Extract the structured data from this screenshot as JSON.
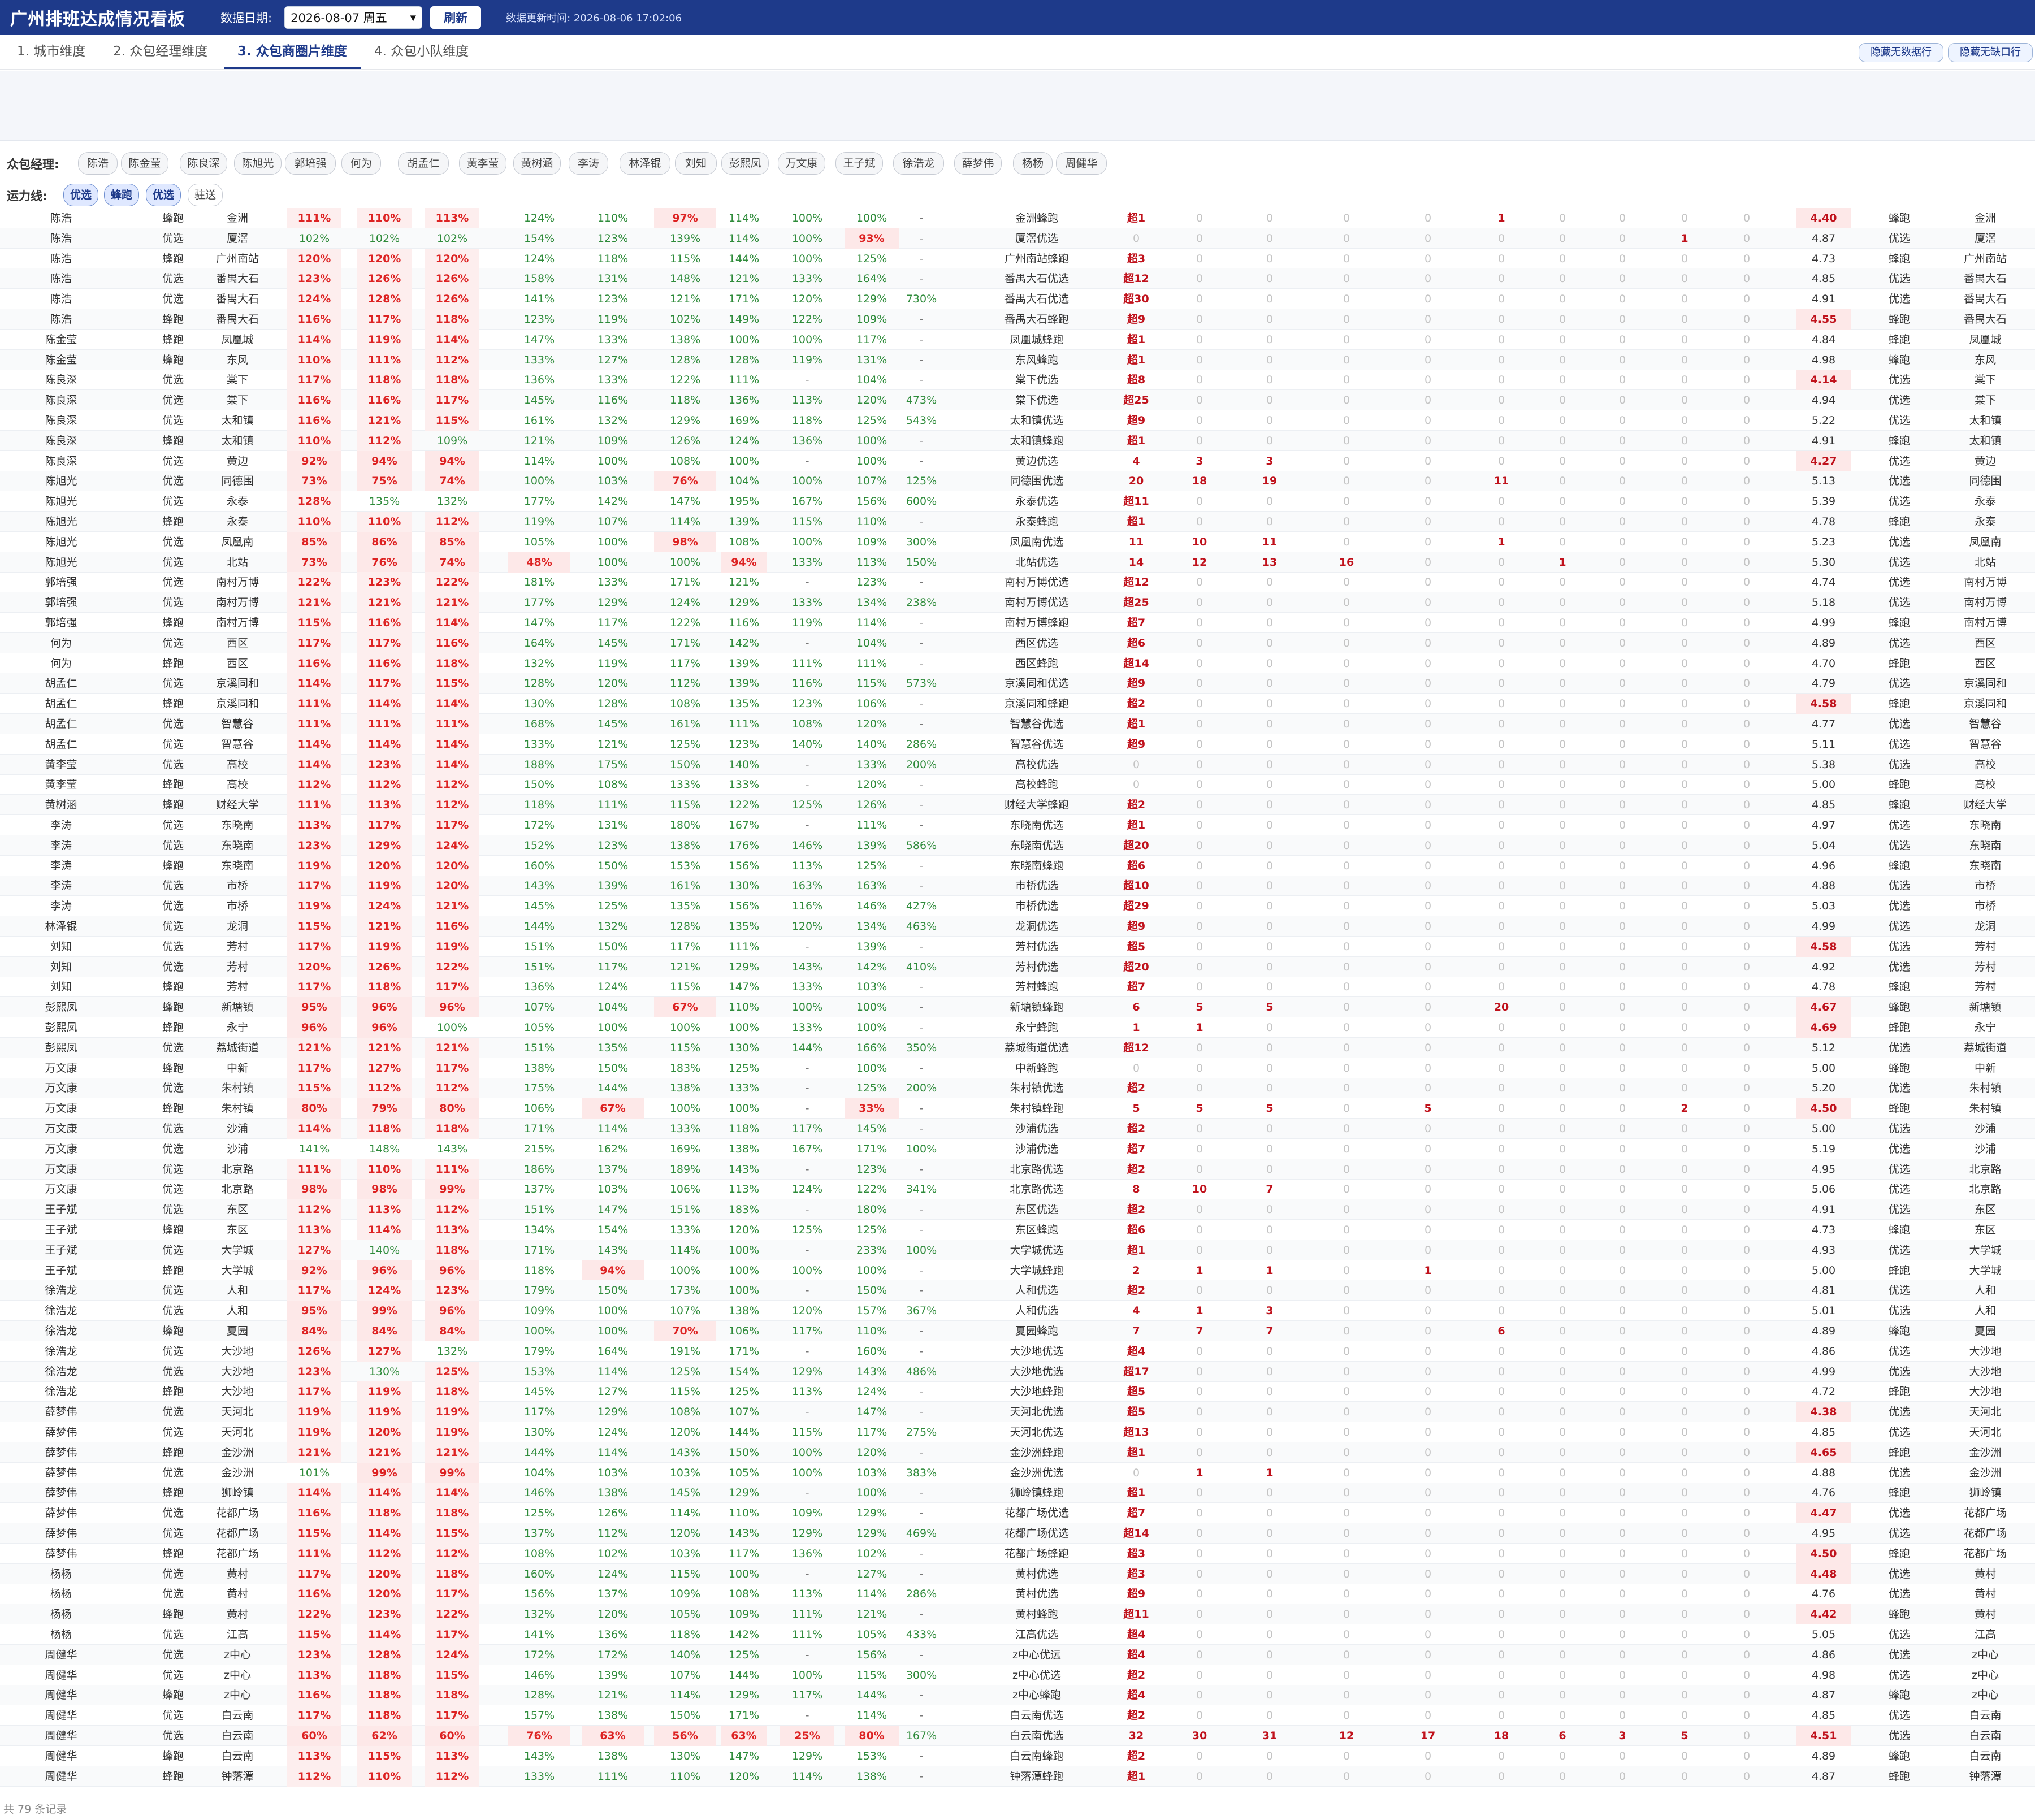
{
  "header": {
    "title": "广州排班达成情况看板",
    "date_label": "数据日期:",
    "date_value": "2026-08-07 周五",
    "refresh_label": "刷新",
    "update_time": "数据更新时间: 2026-08-06 17:02:06"
  },
  "tabs": [
    {
      "label": "1. 城市维度"
    },
    {
      "label": "2. 众包经理维度"
    },
    {
      "label": "3. 众包商圈片维度"
    },
    {
      "label": "4. 众包小队维度"
    }
  ],
  "buttons": {
    "hide_no_data": "隐藏无数据行",
    "hide_no_gap": "隐藏无缺口行"
  },
  "filters": {
    "manager_label": "众包经理:",
    "managers": [
      "陈浩",
      "陈金莹",
      "陈良深",
      "陈旭光",
      "郭培强",
      "何为",
      "胡孟仁",
      "黄李莹",
      "黄树涵",
      "李涛",
      "林泽锟",
      "刘知",
      "彭熙凤",
      "万文康",
      "王子斌",
      "徐浩龙",
      "薛梦伟",
      "杨杨",
      "周健华"
    ],
    "line_label": "运力线:",
    "lines": [
      "优选",
      "蜂跑",
      "优选",
      "驻送"
    ]
  },
  "rows": [
    "陈浩|蜂跑|金洲|111%|110%|113%|124%|110%|97%|114%|100%|100%|-|金洲蜂跑|超1|0|0|0|0|1|0|0|0|0|4.40|蜂跑|金洲",
    "陈浩|优选|厦滘|102%|102%|102%|154%|123%|139%|114%|100%|93%|-|厦滘优选|0|0|0|0|0|0|0|0|1|0|4.87|优选|厦滘",
    "陈浩|蜂跑|广州南站|120%|120%|120%|124%|118%|115%|144%|100%|125%|-|广州南站蜂跑|超3|0|0|0|0|0|0|0|0|0|4.73|蜂跑|广州南站",
    "陈浩|优选|番禺大石|123%|126%|126%|158%|131%|148%|121%|133%|164%|-|番禺大石优选|超12|0|0|0|0|0|0|0|0|0|4.85|优选|番禺大石",
    "陈浩|优选|番禺大石|124%|128%|126%|141%|123%|121%|171%|120%|129%|730%|番禺大石优选|超30|0|0|0|0|0|0|0|0|0|4.91|优选|番禺大石",
    "陈浩|蜂跑|番禺大石|116%|117%|118%|123%|119%|102%|149%|122%|109%|-|番禺大石蜂跑|超9|0|0|0|0|0|0|0|0|0|4.55|蜂跑|番禺大石",
    "陈金莹|蜂跑|凤凰城|114%|119%|114%|147%|133%|138%|100%|100%|117%|-|凤凰城蜂跑|超1|0|0|0|0|0|0|0|0|0|4.84|蜂跑|凤凰城",
    "陈金莹|蜂跑|东风|110%|111%|112%|133%|127%|128%|128%|119%|131%|-|东风蜂跑|超1|0|0|0|0|0|0|0|0|0|4.98|蜂跑|东风",
    "陈良深|优选|棠下|117%|118%|118%|136%|133%|122%|111%|-|104%|-|棠下优选|超8|0|0|0|0|0|0|0|0|0|4.14|优选|棠下",
    "陈良深|优选|棠下|116%|116%|117%|145%|116%|118%|136%|113%|120%|473%|棠下优选|超25|0|0|0|0|0|0|0|0|0|4.94|优选|棠下",
    "陈良深|优选|太和镇|116%|121%|115%|161%|132%|129%|169%|118%|125%|543%|太和镇优选|超9|0|0|0|0|0|0|0|0|0|5.22|优选|太和镇",
    "陈良深|蜂跑|太和镇|110%|112%|109%|121%|109%|126%|124%|136%|100%|-|太和镇蜂跑|超1|0|0|0|0|0|0|0|0|0|4.91|蜂跑|太和镇",
    "陈良深|优选|黄边|92%|94%|94%|114%|100%|108%|100%|-|100%|-|黄边优选|4|3|3|0|0|0|0|0|0|0|4.27|优选|黄边",
    "陈旭光|优选|同德围|73%|75%|74%|100%|103%|76%|104%|100%|107%|125%|同德围优选|20|18|19|0|0|11|0|0|0|0|5.13|优选|同德围",
    "陈旭光|优选|永泰|128%|135%|132%|177%|142%|147%|195%|167%|156%|600%|永泰优选|超11|0|0|0|0|0|0|0|0|0|5.39|优选|永泰",
    "陈旭光|蜂跑|永泰|110%|110%|112%|119%|107%|114%|139%|115%|110%|-|永泰蜂跑|超1|0|0|0|0|0|0|0|0|0|4.78|蜂跑|永泰",
    "陈旭光|优选|凤凰南|85%|86%|85%|105%|100%|98%|108%|100%|109%|300%|凤凰南优选|11|10|11|0|0|1|0|0|0|0|5.23|优选|凤凰南",
    "陈旭光|优选|北站|73%|76%|74%|48%|100%|100%|94%|133%|113%|150%|北站优选|14|12|13|16|0|0|1|0|0|0|5.30|优选|北站",
    "郭培强|优选|南村万博|122%|123%|122%|181%|133%|171%|121%|-|123%|-|南村万博优选|超12|0|0|0|0|0|0|0|0|0|4.74|优选|南村万博",
    "郭培强|优选|南村万博|121%|121%|121%|177%|129%|124%|129%|133%|134%|238%|南村万博优选|超25|0|0|0|0|0|0|0|0|0|5.18|优选|南村万博",
    "郭培强|蜂跑|南村万博|115%|116%|114%|147%|117%|122%|116%|119%|114%|-|南村万博蜂跑|超7|0|0|0|0|0|0|0|0|0|4.99|蜂跑|南村万博",
    "何为|优选|西区|117%|117%|116%|164%|145%|171%|142%|-|104%|-|西区优选|超6|0|0|0|0|0|0|0|0|0|4.89|优选|西区",
    "何为|蜂跑|西区|116%|116%|118%|132%|119%|117%|139%|111%|111%|-|西区蜂跑|超14|0|0|0|0|0|0|0|0|0|4.70|蜂跑|西区",
    "胡孟仁|优选|京溪同和|114%|117%|115%|128%|120%|112%|139%|116%|115%|573%|京溪同和优选|超9|0|0|0|0|0|0|0|0|0|4.79|优选|京溪同和",
    "胡孟仁|蜂跑|京溪同和|111%|114%|114%|130%|128%|108%|135%|123%|106%|-|京溪同和蜂跑|超2|0|0|0|0|0|0|0|0|0|4.58|蜂跑|京溪同和",
    "胡孟仁|优选|智慧谷|111%|111%|111%|168%|145%|161%|111%|108%|120%|-|智慧谷优选|超1|0|0|0|0|0|0|0|0|0|4.77|优选|智慧谷",
    "胡孟仁|优选|智慧谷|114%|114%|114%|133%|121%|125%|123%|140%|140%|286%|智慧谷优选|超9|0|0|0|0|0|0|0|0|0|5.11|优选|智慧谷",
    "黄李莹|优选|高校|114%|123%|114%|188%|175%|150%|140%|-|133%|200%|高校优选|0|0|0|0|0|0|0|0|0|0|5.38|优选|高校",
    "黄李莹|蜂跑|高校|112%|112%|112%|150%|108%|133%|133%|-|120%|-|高校蜂跑|0|0|0|0|0|0|0|0|0|0|5.00|蜂跑|高校",
    "黄树涵|蜂跑|财经大学|111%|113%|112%|118%|111%|115%|122%|125%|126%|-|财经大学蜂跑|超2|0|0|0|0|0|0|0|0|0|4.85|蜂跑|财经大学",
    "李涛|优选|东晓南|113%|117%|117%|172%|131%|180%|167%|-|111%|-|东晓南优选|超1|0|0|0|0|0|0|0|0|0|4.97|优选|东晓南",
    "李涛|优选|东晓南|123%|129%|124%|152%|123%|138%|176%|146%|139%|586%|东晓南优选|超20|0|0|0|0|0|0|0|0|0|5.04|优选|东晓南",
    "李涛|蜂跑|东晓南|119%|120%|120%|160%|150%|153%|156%|113%|125%|-|东晓南蜂跑|超6|0|0|0|0|0|0|0|0|0|4.96|蜂跑|东晓南",
    "李涛|优选|市桥|117%|119%|120%|143%|139%|161%|130%|163%|163%|-|市桥优选|超10|0|0|0|0|0|0|0|0|0|4.88|优选|市桥",
    "李涛|优选|市桥|119%|124%|121%|145%|125%|135%|156%|116%|146%|427%|市桥优选|超29|0|0|0|0|0|0|0|0|0|5.03|优选|市桥",
    "林泽锟|优选|龙洞|115%|121%|116%|144%|132%|128%|135%|120%|134%|463%|龙洞优选|超9|0|0|0|0|0|0|0|0|0|4.99|优选|龙洞",
    "刘知|优选|芳村|117%|119%|119%|151%|150%|117%|111%|-|139%|-|芳村优选|超5|0|0|0|0|0|0|0|0|0|4.58|优选|芳村",
    "刘知|优选|芳村|120%|126%|122%|151%|117%|121%|129%|143%|142%|410%|芳村优选|超20|0|0|0|0|0|0|0|0|0|4.92|优选|芳村",
    "刘知|蜂跑|芳村|117%|118%|117%|136%|124%|115%|147%|133%|103%|-|芳村蜂跑|超7|0|0|0|0|0|0|0|0|0|4.78|蜂跑|芳村",
    "彭熙凤|蜂跑|新塘镇|95%|96%|96%|107%|104%|67%|110%|100%|100%|-|新塘镇蜂跑|6|5|5|0|0|20|0|0|0|0|4.67|蜂跑|新塘镇",
    "彭熙凤|蜂跑|永宁|96%|96%|100%|105%|100%|100%|100%|133%|100%|-|永宁蜂跑|1|1|0|0|0|0|0|0|0|0|4.69|蜂跑|永宁",
    "彭熙凤|优选|荔城街道|121%|121%|121%|151%|135%|115%|130%|144%|166%|350%|荔城街道优选|超12|0|0|0|0|0|0|0|0|0|5.12|优选|荔城街道",
    "万文康|蜂跑|中新|117%|127%|117%|138%|150%|183%|125%|-|100%|-|中新蜂跑|0|0|0|0|0|0|0|0|0|0|5.00|蜂跑|中新",
    "万文康|优选|朱村镇|115%|112%|112%|175%|144%|138%|133%|-|125%|200%|朱村镇优选|超2|0|0|0|0|0|0|0|0|0|5.20|优选|朱村镇",
    "万文康|蜂跑|朱村镇|80%|79%|80%|106%|67%|100%|100%|-|33%|-|朱村镇蜂跑|5|5|5|0|5|0|0|0|2|0|4.50|蜂跑|朱村镇",
    "万文康|优选|沙浦|114%|118%|118%|171%|114%|133%|118%|117%|145%|-|沙浦优选|超2|0|0|0|0|0|0|0|0|0|5.00|优选|沙浦",
    "万文康|优选|沙浦|141%|148%|143%|215%|162%|169%|138%|167%|171%|100%|沙浦优选|超7|0|0|0|0|0|0|0|0|0|5.19|优选|沙浦",
    "万文康|优选|北京路|111%|110%|111%|186%|137%|189%|143%|-|123%|-|北京路优选|超2|0|0|0|0|0|0|0|0|0|4.95|优选|北京路",
    "万文康|优选|北京路|98%|98%|99%|137%|103%|106%|113%|124%|122%|341%|北京路优选|8|10|7|0|0|0|0|0|0|0|5.06|优选|北京路",
    "王子斌|优选|东区|112%|113%|112%|151%|147%|151%|183%|-|180%|-|东区优选|超2|0|0|0|0|0|0|0|0|0|4.91|优选|东区",
    "王子斌|蜂跑|东区|113%|114%|113%|134%|154%|133%|120%|125%|138%|125%|-|东区蜂跑|超6|0|0|0|0|0|0|0|0|0|4.73|蜂跑|东区",
    "王子斌|优选|大学城|127%|140%|118%|171%|143%|114%|100%|-|233%|100%|大学城优选|超1|0|0|0|0|0|0|0|0|0|4.93|优选|大学城",
    "王子斌|蜂跑|大学城|92%|96%|96%|118%|94%|100%|100%|100%|100%|-|大学城蜂跑|2|1|1|0|1|0|0|0|0|0|5.00|蜂跑|大学城",
    "徐浩龙|优选|人和|117%|124%|123%|179%|150%|173%|100%|-|150%|-|人和优选|超2|0|0|0|0|0|0|0|0|0|4.81|优选|人和",
    "徐浩龙|优选|人和|95%|99%|96%|109%|100%|107%|138%|120%|157%|367%|人和优选|4|1|3|0|0|0|0|0|0|0|5.01|优选|人和",
    "徐浩龙|蜂跑|夏园|84%|84%|84%|100%|100%|70%|106%|117%|110%|-|夏园蜂跑|7|7|7|0|0|6|0|0|0|0|4.89|蜂跑|夏园",
    "徐浩龙|优选|大沙地|126%|127%|132%|179%|164%|191%|171%|-|160%|-|大沙地优选|超4|0|0|0|0|0|0|0|0|0|4.86|优选|大沙地",
    "徐浩龙|优选|大沙地|123%|130%|125%|153%|114%|125%|154%|129%|143%|486%|大沙地优选|超17|0|0|0|0|0|0|0|0|0|4.99|优选|大沙地",
    "徐浩龙|蜂跑|大沙地|117%|119%|118%|145%|127%|115%|125%|113%|124%|-|大沙地蜂跑|超5|0|0|0|0|0|0|0|0|0|4.72|蜂跑|大沙地",
    "薛梦伟|优选|天河北|119%|119%|119%|117%|129%|108%|107%|-|147%|-|天河北优选|超5|0|0|0|0|0|0|0|0|0|4.38|优选|天河北",
    "薛梦伟|优选|天河北|119%|120%|119%|130%|124%|120%|144%|115%|117%|275%|天河北优选|超13|0|0|0|0|0|0|0|0|0|4.85|优选|天河北",
    "薛梦伟|蜂跑|金沙洲|121%|121%|121%|144%|114%|143%|150%|100%|120%|-|金沙洲蜂跑|超1|0|0|0|0|0|0|0|0|0|4.65|蜂跑|金沙洲",
    "薛梦伟|优选|金沙洲|101%|99%|99%|104%|103%|103%|105%|100%|103%|383%|金沙洲优选|0|1|1|0|0|0|0|0|0|0|4.88|优选|金沙洲",
    "薛梦伟|蜂跑|狮岭镇|114%|114%|114%|146%|138%|145%|129%|-|100%|-|狮岭镇蜂跑|超1|0|0|0|0|0|0|0|0|0|4.76|蜂跑|狮岭镇",
    "薛梦伟|优选|花都广场|116%|118%|118%|125%|126%|114%|110%|109%|129%|-|花都广场优选|超7|0|0|0|0|0|0|0|0|0|4.47|优选|花都广场",
    "薛梦伟|优选|花都广场|115%|114%|115%|137%|112%|120%|143%|129%|129%|469%|花都广场优选|超14|0|0|0|0|0|0|0|0|0|4.95|优选|花都广场",
    "薛梦伟|蜂跑|花都广场|111%|112%|112%|108%|102%|103%|117%|136%|102%|-|花都广场蜂跑|超3|0|0|0|0|0|0|0|0|0|4.50|蜂跑|花都广场",
    "杨杨|优选|黄村|117%|120%|118%|160%|124%|115%|100%|-|127%|-|黄村优选|超3|0|0|0|0|0|0|0|0|0|4.48|优选|黄村",
    "杨杨|优选|黄村|116%|120%|117%|156%|137%|109%|108%|113%|114%|286%|黄村优选|超9|0|0|0|0|0|0|0|0|0|4.76|优选|黄村",
    "杨杨|蜂跑|黄村|122%|123%|122%|132%|120%|105%|109%|111%|121%|-|黄村蜂跑|超11|0|0|0|0|0|0|0|0|0|4.42|蜂跑|黄村",
    "杨杨|优选|江高|115%|114%|117%|141%|136%|118%|142%|111%|105%|433%|江高优选|超4|0|0|0|0|0|0|0|0|0|5.05|优选|江高",
    "周健华|优选|z中心|123%|128%|124%|172%|172%|140%|125%|-|156%|-|z中心优远|超4|0|0|0|0|0|0|0|0|0|4.86|优选|z中心",
    "周健华|优选|z中心|113%|118%|115%|146%|139%|107%|144%|100%|115%|300%|z中心优选|超2|0|0|0|0|0|0|0|0|0|4.98|优选|z中心",
    "周健华|蜂跑|z中心|116%|118%|118%|128%|121%|114%|129%|117%|144%|-|z中心蜂跑|超4|0|0|0|0|0|0|0|0|0|4.87|蜂跑|z中心",
    "周健华|优选|白云南|117%|118%|117%|157%|138%|150%|171%|-|114%|-|白云南优选|超2|0|0|0|0|0|0|0|0|0|4.85|优选|白云南",
    "周健华|优选|白云南|60%|62%|60%|76%|63%|56%|63%|25%|80%|167%|白云南优选|32|30|31|12|17|18|6|3|5|0|4.51|优选|白云南",
    "周健华|蜂跑|白云南|113%|115%|113%|143%|138%|130%|147%|129%|153%|-|白云南蜂跑|超2|0|0|0|0|0|0|0|0|0|4.89|蜂跑|白云南",
    "周健华|蜂跑|钟落潭|112%|110%|112%|133%|111%|110%|120%|114%|138%|-|钟落潭蜂跑|超1|0|0|0|0|0|0|0|0|0|4.87|蜂跑|钟落潭"
  ],
  "footer": "共 79 条记录"
}
